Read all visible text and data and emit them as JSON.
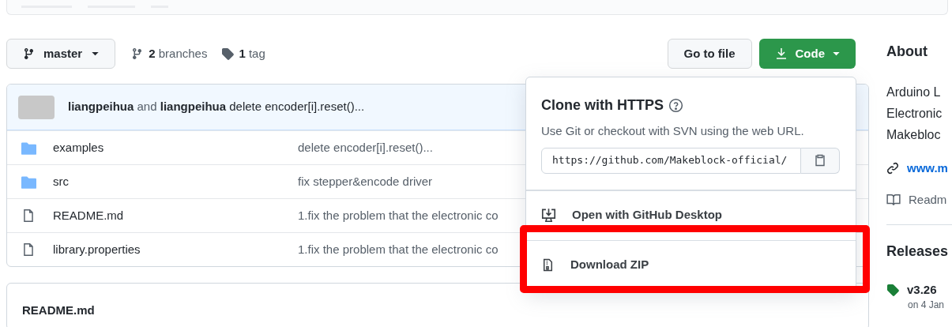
{
  "branch_button": {
    "label": "master"
  },
  "branches": {
    "count": "2",
    "label": "branches"
  },
  "tags": {
    "count": "1",
    "label": "tag"
  },
  "go_to_file": {
    "label": "Go to file"
  },
  "code_button": {
    "label": "Code"
  },
  "latest_commit": {
    "author": "liangpeihua",
    "joiner": "and",
    "coauthor": "liangpeihua",
    "message": "delete encoder[i].reset()..."
  },
  "files": [
    {
      "kind": "folder",
      "name": "examples",
      "message": "delete encoder[i].reset()..."
    },
    {
      "kind": "folder",
      "name": "src",
      "message": "fix stepper&encode driver"
    },
    {
      "kind": "file",
      "name": "README.md",
      "message": "1.fix the problem that the electronic co"
    },
    {
      "kind": "file",
      "name": "library.properties",
      "message": "1.fix the problem that the electronic co"
    }
  ],
  "readme": {
    "title": "README.md"
  },
  "clone_menu": {
    "title": "Clone with HTTPS",
    "description": "Use Git or checkout with SVN using the web URL.",
    "url": "https://github.com/Makeblock-official/",
    "items": [
      {
        "kind": "desktop",
        "label": "Open with GitHub Desktop"
      },
      {
        "kind": "zip",
        "label": "Download ZIP",
        "highlighted": true
      }
    ]
  },
  "about": {
    "title": "About",
    "description_lines": [
      "Arduino L",
      "Electronic",
      "Makebloc"
    ],
    "link": "www.m",
    "readme": "Readm"
  },
  "releases": {
    "title": "Releases",
    "tag": "v3.26",
    "date": "on 4 Jan"
  }
}
